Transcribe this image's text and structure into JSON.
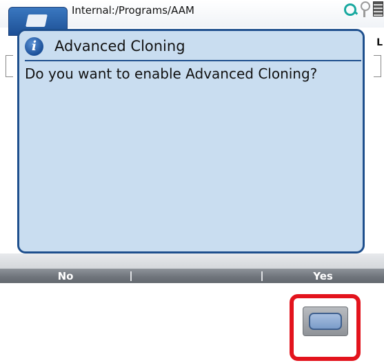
{
  "titlebar": {
    "path": "Internal:/Programs/AAM"
  },
  "background": {
    "right_letter": "L"
  },
  "dialog": {
    "icon": "info-icon",
    "title": "Advanced Cloning",
    "message": "Do you want to enable Advanced Cloning?"
  },
  "softkeys": {
    "left_label": "No",
    "middle_label": "",
    "right_label": "Yes"
  },
  "hardware": {
    "highlight_color": "#e3141d",
    "key_icon": "softkey-right-button"
  },
  "colors": {
    "dialog_bg": "#c9ddf0",
    "dialog_border": "#1e4f8d",
    "softkey_bar": "#6f747b"
  }
}
